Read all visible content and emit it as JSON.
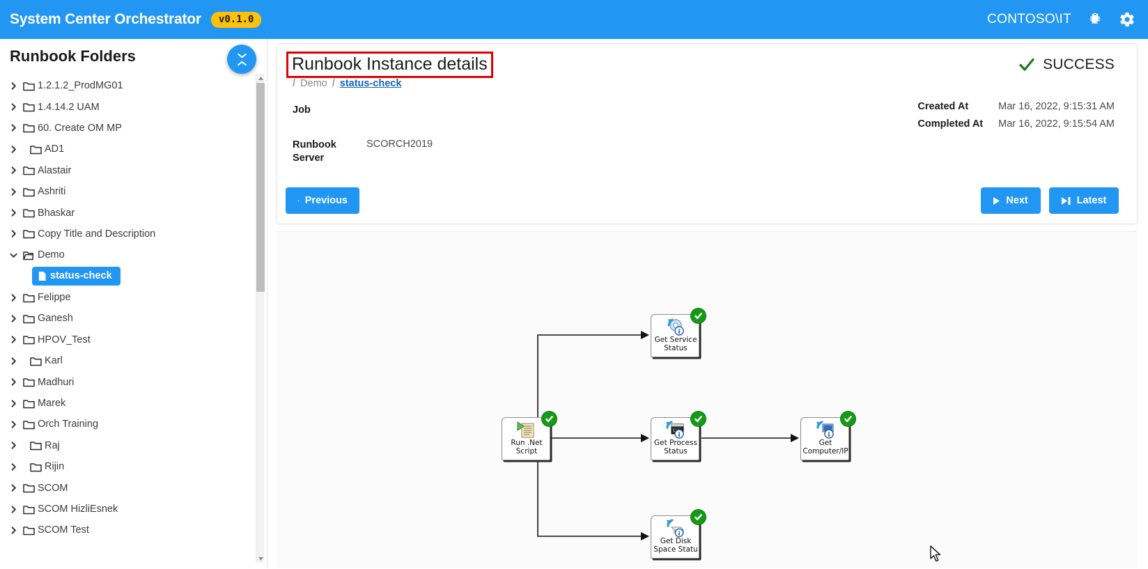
{
  "topbar": {
    "brand": "System Center Orchestrator",
    "version": "v0.1.0",
    "user": "CONTOSO\\IT",
    "bug_icon": "bug-icon",
    "settings_icon": "gear-icon",
    "background": "#2196f3",
    "badge_color": "#ffc107"
  },
  "sidebar": {
    "title": "Runbook Folders",
    "collapse_icon": "double-chevron-collapse-icon",
    "selected_item": "status-check",
    "items": [
      {
        "label": "1.2.1.2_ProdMG01",
        "type": "folder",
        "expanded": false,
        "indented": false
      },
      {
        "label": "1.4.14.2 UAM",
        "type": "folder",
        "expanded": false,
        "indented": false
      },
      {
        "label": "60. Create OM MP",
        "type": "folder",
        "expanded": false,
        "indented": false
      },
      {
        "label": "AD1",
        "type": "folder",
        "expanded": false,
        "indented": true
      },
      {
        "label": "Alastair",
        "type": "folder",
        "expanded": false,
        "indented": false
      },
      {
        "label": "Ashriti",
        "type": "folder",
        "expanded": false,
        "indented": false
      },
      {
        "label": "Bhaskar",
        "type": "folder",
        "expanded": false,
        "indented": false
      },
      {
        "label": "Copy Title and Description",
        "type": "folder",
        "expanded": false,
        "indented": false
      },
      {
        "label": "Demo",
        "type": "folder",
        "expanded": true,
        "indented": false
      },
      {
        "label": "status-check",
        "type": "runbook",
        "selected": true
      },
      {
        "label": "Felippe",
        "type": "folder",
        "expanded": false,
        "indented": false
      },
      {
        "label": "Ganesh",
        "type": "folder",
        "expanded": false,
        "indented": false
      },
      {
        "label": "HPOV_Test",
        "type": "folder",
        "expanded": false,
        "indented": false
      },
      {
        "label": "Karl",
        "type": "folder",
        "expanded": false,
        "indented": true
      },
      {
        "label": "Madhuri",
        "type": "folder",
        "expanded": false,
        "indented": false
      },
      {
        "label": "Marek",
        "type": "folder",
        "expanded": false,
        "indented": false
      },
      {
        "label": "Orch Training",
        "type": "folder",
        "expanded": false,
        "indented": false
      },
      {
        "label": "Raj",
        "type": "folder",
        "expanded": false,
        "indented": true
      },
      {
        "label": "Rijin",
        "type": "folder",
        "expanded": false,
        "indented": true
      },
      {
        "label": "SCOM",
        "type": "folder",
        "expanded": false,
        "indented": false
      },
      {
        "label": "SCOM HizliEsnek",
        "type": "folder",
        "expanded": false,
        "indented": false
      },
      {
        "label": "SCOM Test",
        "type": "folder",
        "expanded": false,
        "indented": false
      }
    ]
  },
  "details": {
    "title": "Runbook Instance details",
    "title_highlight_color": "#e00000",
    "breadcrumb": {
      "separator": "/",
      "folder": "Demo",
      "current": "status-check"
    },
    "job_label": "Job",
    "server_key": "Runbook Server",
    "server_value": "SCORCH2019",
    "status": {
      "text": "SUCCESS",
      "icon": "check-icon",
      "color": "#1a7a1a"
    },
    "times": [
      {
        "key": "Created At",
        "value": "Mar 16, 2022, 9:15:31 AM"
      },
      {
        "key": "Completed At",
        "value": "Mar 16, 2022, 9:15:54 AM"
      }
    ],
    "buttons": {
      "previous": "Previous",
      "next": "Next",
      "latest": "Latest"
    }
  },
  "diagram": {
    "nodes": [
      {
        "id": "run-net-script",
        "label": "Run .Net Script",
        "icon": "script-play-icon",
        "status": "success"
      },
      {
        "id": "get-service-status",
        "label": "Get Service Status",
        "icon": "service-gear-icon",
        "status": "success"
      },
      {
        "id": "get-process-status",
        "label": "Get Process Status",
        "icon": "process-window-icon",
        "status": "success"
      },
      {
        "id": "get-computer-ip",
        "label": "Get Computer/IP",
        "icon": "computer-monitor-icon",
        "status": "success"
      },
      {
        "id": "get-disk-space-status",
        "label": "Get Disk Space Statu",
        "icon": "disk-drive-icon",
        "status": "success"
      }
    ],
    "links": [
      {
        "from": "run-net-script",
        "to": "get-service-status"
      },
      {
        "from": "run-net-script",
        "to": "get-process-status"
      },
      {
        "from": "get-process-status",
        "to": "get-computer-ip"
      },
      {
        "from": "run-net-script",
        "to": "get-disk-space-status"
      }
    ],
    "cursor": "mouse-pointer"
  }
}
